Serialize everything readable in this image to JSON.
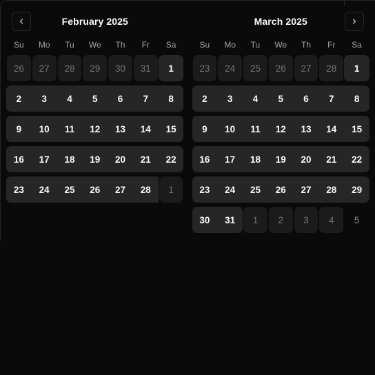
{
  "theme": {
    "page_bg": "#0a0a0a",
    "panel_bg": "#0a0a0a",
    "panel_border": "#242424",
    "in_month_cell_bg": "#262626",
    "out_month_cell_bg": "#1b1b1b",
    "in_month_text": "#fafafa",
    "out_month_text": "#737373",
    "weekday_text": "#a3a3a3",
    "nav_border": "#27272a"
  },
  "nav": {
    "prev_label": "‹",
    "next_label": "›",
    "prev_icon": "chevron-left-icon",
    "next_icon": "chevron-right-icon"
  },
  "weekdays": [
    "Su",
    "Mo",
    "Tu",
    "We",
    "Th",
    "Fr",
    "Sa"
  ],
  "months": [
    {
      "title": "February 2025",
      "weeks": [
        [
          {
            "day": "26",
            "state": "out"
          },
          {
            "day": "27",
            "state": "out"
          },
          {
            "day": "28",
            "state": "out"
          },
          {
            "day": "29",
            "state": "out"
          },
          {
            "day": "30",
            "state": "out"
          },
          {
            "day": "31",
            "state": "out"
          },
          {
            "day": "1",
            "state": "in",
            "round": "both"
          }
        ],
        [
          {
            "day": "2",
            "state": "in",
            "round": "start"
          },
          {
            "day": "3",
            "state": "in"
          },
          {
            "day": "4",
            "state": "in"
          },
          {
            "day": "5",
            "state": "in"
          },
          {
            "day": "6",
            "state": "in"
          },
          {
            "day": "7",
            "state": "in"
          },
          {
            "day": "8",
            "state": "in",
            "round": "end"
          }
        ],
        [
          {
            "day": "9",
            "state": "in",
            "round": "start"
          },
          {
            "day": "10",
            "state": "in"
          },
          {
            "day": "11",
            "state": "in"
          },
          {
            "day": "12",
            "state": "in"
          },
          {
            "day": "13",
            "state": "in"
          },
          {
            "day": "14",
            "state": "in"
          },
          {
            "day": "15",
            "state": "in",
            "round": "end"
          }
        ],
        [
          {
            "day": "16",
            "state": "in",
            "round": "start"
          },
          {
            "day": "17",
            "state": "in"
          },
          {
            "day": "18",
            "state": "in"
          },
          {
            "day": "19",
            "state": "in"
          },
          {
            "day": "20",
            "state": "in"
          },
          {
            "day": "21",
            "state": "in"
          },
          {
            "day": "22",
            "state": "in",
            "round": "end"
          }
        ],
        [
          {
            "day": "23",
            "state": "in",
            "round": "start"
          },
          {
            "day": "24",
            "state": "in"
          },
          {
            "day": "25",
            "state": "in"
          },
          {
            "day": "26",
            "state": "in"
          },
          {
            "day": "27",
            "state": "in"
          },
          {
            "day": "28",
            "state": "in"
          },
          {
            "day": "1",
            "state": "out"
          }
        ]
      ]
    },
    {
      "title": "March 2025",
      "weeks": [
        [
          {
            "day": "23",
            "state": "out"
          },
          {
            "day": "24",
            "state": "out"
          },
          {
            "day": "25",
            "state": "out"
          },
          {
            "day": "26",
            "state": "out"
          },
          {
            "day": "27",
            "state": "out"
          },
          {
            "day": "28",
            "state": "out"
          },
          {
            "day": "1",
            "state": "in",
            "round": "both"
          }
        ],
        [
          {
            "day": "2",
            "state": "in",
            "round": "start"
          },
          {
            "day": "3",
            "state": "in"
          },
          {
            "day": "4",
            "state": "in"
          },
          {
            "day": "5",
            "state": "in"
          },
          {
            "day": "6",
            "state": "in"
          },
          {
            "day": "7",
            "state": "in"
          },
          {
            "day": "8",
            "state": "in",
            "round": "end"
          }
        ],
        [
          {
            "day": "9",
            "state": "in",
            "round": "start"
          },
          {
            "day": "10",
            "state": "in"
          },
          {
            "day": "11",
            "state": "in"
          },
          {
            "day": "12",
            "state": "in"
          },
          {
            "day": "13",
            "state": "in"
          },
          {
            "day": "14",
            "state": "in"
          },
          {
            "day": "15",
            "state": "in",
            "round": "end"
          }
        ],
        [
          {
            "day": "16",
            "state": "in",
            "round": "start"
          },
          {
            "day": "17",
            "state": "in"
          },
          {
            "day": "18",
            "state": "in"
          },
          {
            "day": "19",
            "state": "in"
          },
          {
            "day": "20",
            "state": "in"
          },
          {
            "day": "21",
            "state": "in"
          },
          {
            "day": "22",
            "state": "in",
            "round": "end"
          }
        ],
        [
          {
            "day": "23",
            "state": "in",
            "round": "start"
          },
          {
            "day": "24",
            "state": "in"
          },
          {
            "day": "25",
            "state": "in"
          },
          {
            "day": "26",
            "state": "in"
          },
          {
            "day": "27",
            "state": "in"
          },
          {
            "day": "28",
            "state": "in"
          },
          {
            "day": "29",
            "state": "in",
            "round": "end"
          }
        ],
        [
          {
            "day": "30",
            "state": "in",
            "round": "start"
          },
          {
            "day": "31",
            "state": "in",
            "round": "end"
          },
          {
            "day": "1",
            "state": "out"
          },
          {
            "day": "2",
            "state": "out"
          },
          {
            "day": "3",
            "state": "out"
          },
          {
            "day": "4",
            "state": "out"
          },
          {
            "day": "5",
            "state": "bare"
          }
        ]
      ]
    }
  ]
}
